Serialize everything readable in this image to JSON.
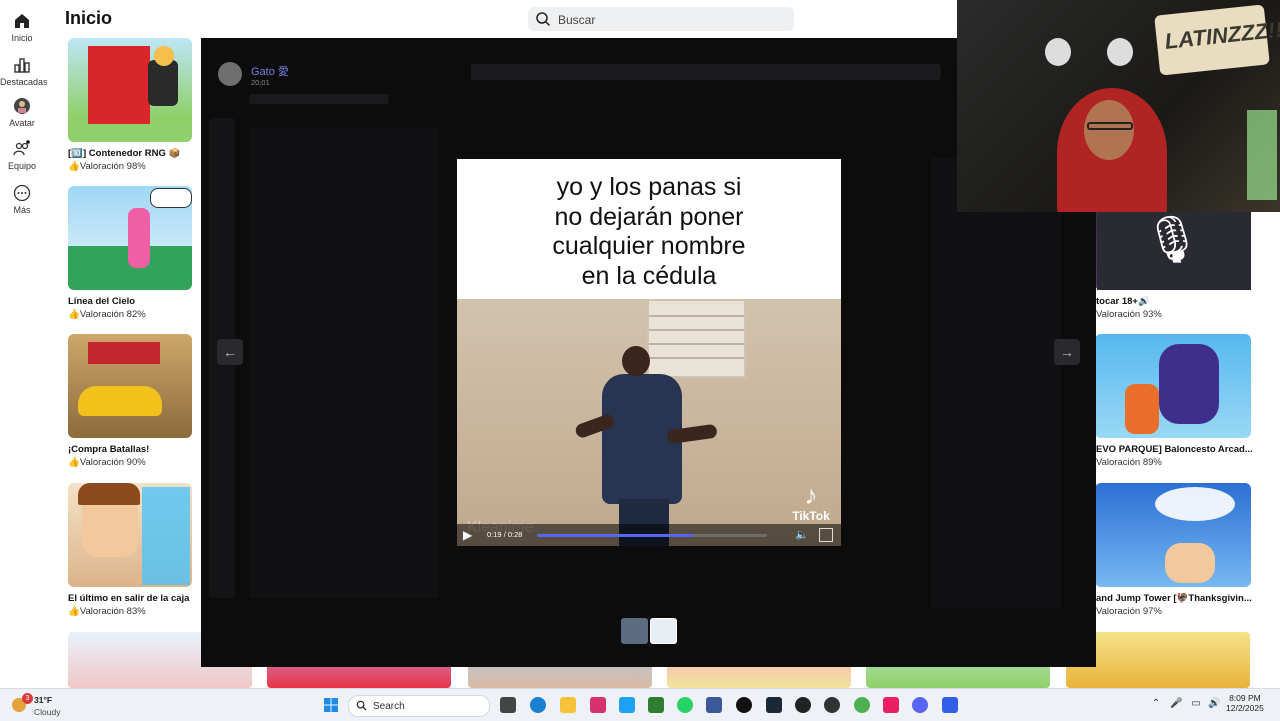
{
  "rail": {
    "items": [
      {
        "label": "Inicio"
      },
      {
        "label": "Destacadas"
      },
      {
        "label": "Avatar"
      },
      {
        "label": "Equipo"
      },
      {
        "label": "Más"
      }
    ]
  },
  "page": {
    "title": "Inicio"
  },
  "search": {
    "placeholder": "Buscar"
  },
  "games_left": [
    {
      "name": "[🔟] Contenedor RNG 📦",
      "rating": "Valoración 98%"
    },
    {
      "name": "Línea del Cielo",
      "rating": "Valoración 82%"
    },
    {
      "name": "¡Compra Batallas!",
      "rating": "Valoración 90%"
    },
    {
      "name": "El último en salir de la caja",
      "rating": "Valoración 83%"
    }
  ],
  "games_right": [
    {
      "name": "tocar 18+🔊",
      "rating": "Valoración 93%"
    },
    {
      "name": "EVO PARQUE] Baloncesto Arcad...",
      "rating": "Valoración 89%"
    },
    {
      "name": "and Jump Tower [🦃Thanksgivin...",
      "rating": "Valoración 97%"
    }
  ],
  "discord": {
    "sender": "Gato 愛",
    "time": "20:01",
    "prev_icon": "arrow-left-icon",
    "next_icon": "arrow-right-icon"
  },
  "video": {
    "caption_lines": [
      "yo y los panas si",
      "no dejarán poner",
      "cualquier nombre",
      "en la cédula"
    ],
    "current_time": "0:19",
    "duration": "0:28",
    "progress": 0.68,
    "brand": "TikTok"
  },
  "taskbar": {
    "temperature": "31°F",
    "condition": "Cloudy",
    "notification_count": "3",
    "search_placeholder": "Search",
    "time": "8:09 PM",
    "date": "12/2/2025"
  },
  "colors": {
    "accent": "#5865f2",
    "overlay": "#0c0c0d",
    "discord_username": "#7a7fd9"
  }
}
